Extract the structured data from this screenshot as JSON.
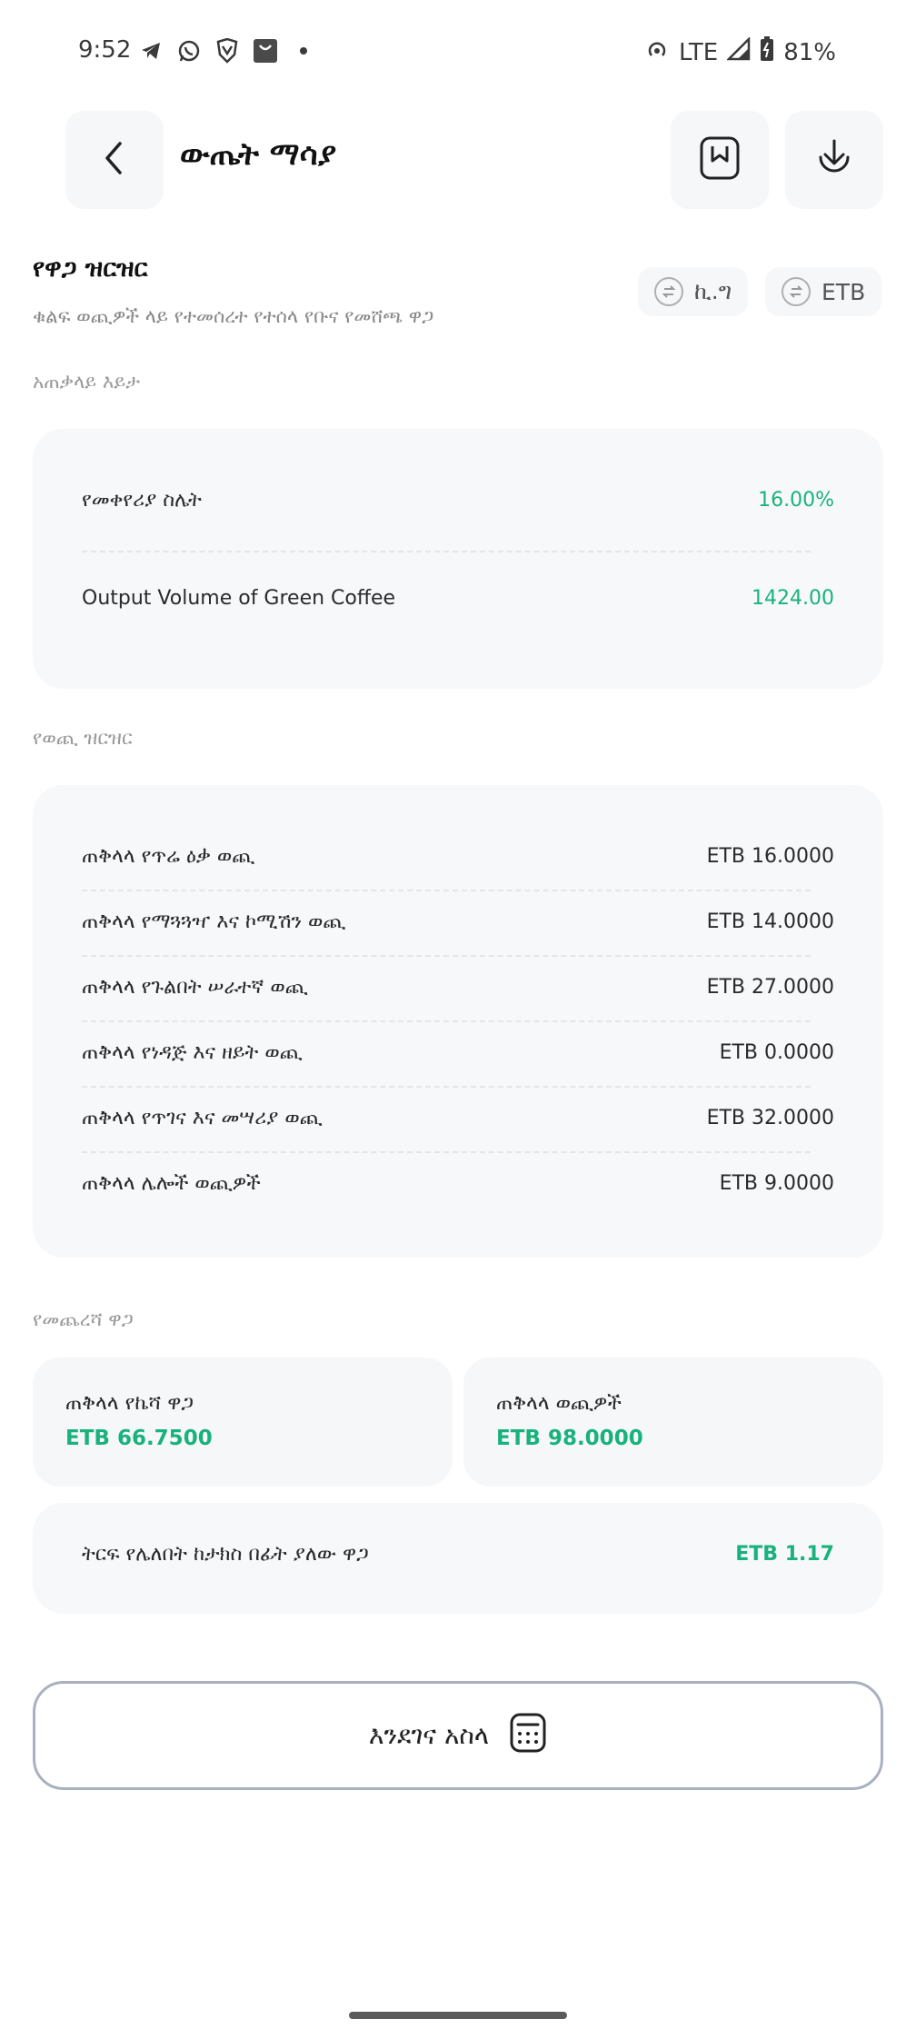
{
  "status_bar": {
    "time": "9:52",
    "network": "LTE",
    "battery": "81%",
    "left_icons": [
      "telegram-icon",
      "whatsapp-icon",
      "shield-icon",
      "shopping-bag-icon"
    ],
    "right_icons": [
      "hotspot-icon",
      "signal-icon",
      "battery-icon"
    ]
  },
  "header": {
    "title": "ውጤት ማሳያ",
    "back_icon": "chevron-left-icon",
    "bookmark_icon": "bookmark-icon",
    "download_icon": "download-icon"
  },
  "price_breakdown": {
    "title": "የዋጋ ዝርዝር",
    "subtitle": "ቁልፍ ወጪዎች ላይ የተመሰረተ የተሰላ የቡና የመሸጫ ዋጋ",
    "unit_chip": "ኪ.ግ",
    "currency_chip": "ETB"
  },
  "overview": {
    "label": "አጠቃላይ እይታ",
    "rows": [
      {
        "label": "የመቀየሪያ ስሌት",
        "value": "16.00%"
      },
      {
        "label": "Output Volume of Green Coffee",
        "value": "1424.00"
      }
    ]
  },
  "expenses": {
    "label": "የወጪ ዝርዝር",
    "rows": [
      {
        "label": "ጠቅላላ የጥሬ ዕቃ ወጪ",
        "value": "ETB 16.0000"
      },
      {
        "label": "ጠቅላላ የማጓጓዣ እና ኮሚሽን ወጪ",
        "value": "ETB 14.0000"
      },
      {
        "label": "ጠቅላላ የጉልበት ሠራተኛ ወጪ",
        "value": "ETB 27.0000"
      },
      {
        "label": "ጠቅላላ የነዳጅ እና ዘይት ወጪ",
        "value": "ETB 0.0000"
      },
      {
        "label": "ጠቅላላ የጥገና እና መሣሪያ ወጪ",
        "value": "ETB 32.0000"
      },
      {
        "label": "ጠቅላላ ሌሎች ወጪዎች",
        "value": "ETB 9.0000"
      }
    ]
  },
  "final_price": {
    "label": "የመጨረሻ ዋጋ",
    "per_kg_label": "ጠቅላላ የኬሻ ዋጋ",
    "per_kg_value": "ETB 66.7500",
    "total_label": "ጠቅላላ ወጪዎች",
    "total_value": "ETB 98.0000",
    "pre_tax_label": "ትርፍ የሌለበት ከታክስ በፊት ያለው ዋጋ",
    "pre_tax_value": "ETB 1.17"
  },
  "recalculate_button": {
    "label": "እንደገና አስላ",
    "icon": "calculator-icon"
  },
  "colors": {
    "accent_green": "#19b27c",
    "card_bg": "#f7f8fa",
    "button_border": "#a9b0c0"
  }
}
